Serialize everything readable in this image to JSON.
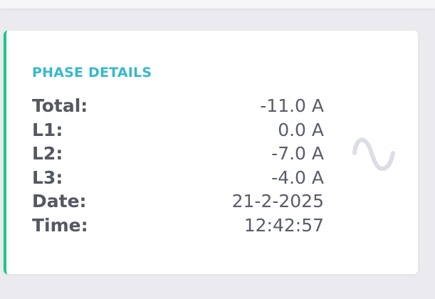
{
  "card": {
    "title": "PHASE DETAILS",
    "icon": "sine-wave-icon",
    "accent_color": "#1cc88a",
    "title_color": "#36b9cc",
    "rows": [
      {
        "label": "Total:",
        "value": "-11.0 A"
      },
      {
        "label": "L1:",
        "value": "0.0 A"
      },
      {
        "label": "L2:",
        "value": "-7.0 A"
      },
      {
        "label": "L3:",
        "value": "-4.0 A"
      },
      {
        "label": "Date:",
        "value": "21-2-2025"
      },
      {
        "label": "Time:",
        "value": "12:42:57"
      }
    ]
  }
}
